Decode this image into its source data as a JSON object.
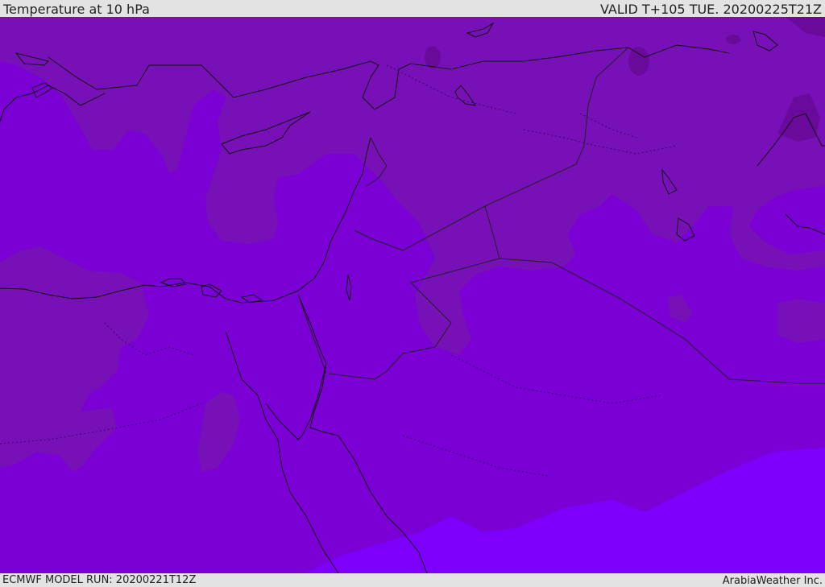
{
  "header": {
    "title": "Temperature at 10 hPa",
    "valid": "VALID T+105 TUE. 20200225T21Z"
  },
  "footer": {
    "model_run": "ECMWF MODEL RUN: 20200221T12Z",
    "credit": "ArabiaWeather Inc."
  },
  "map": {
    "colors": {
      "warmest_band": "#7d00fd",
      "mid_band": "#7a00d6",
      "cool_band": "#7710b6",
      "coldest_band": "#6a0a9a",
      "coastline": "#111111",
      "border": "#222222"
    }
  }
}
